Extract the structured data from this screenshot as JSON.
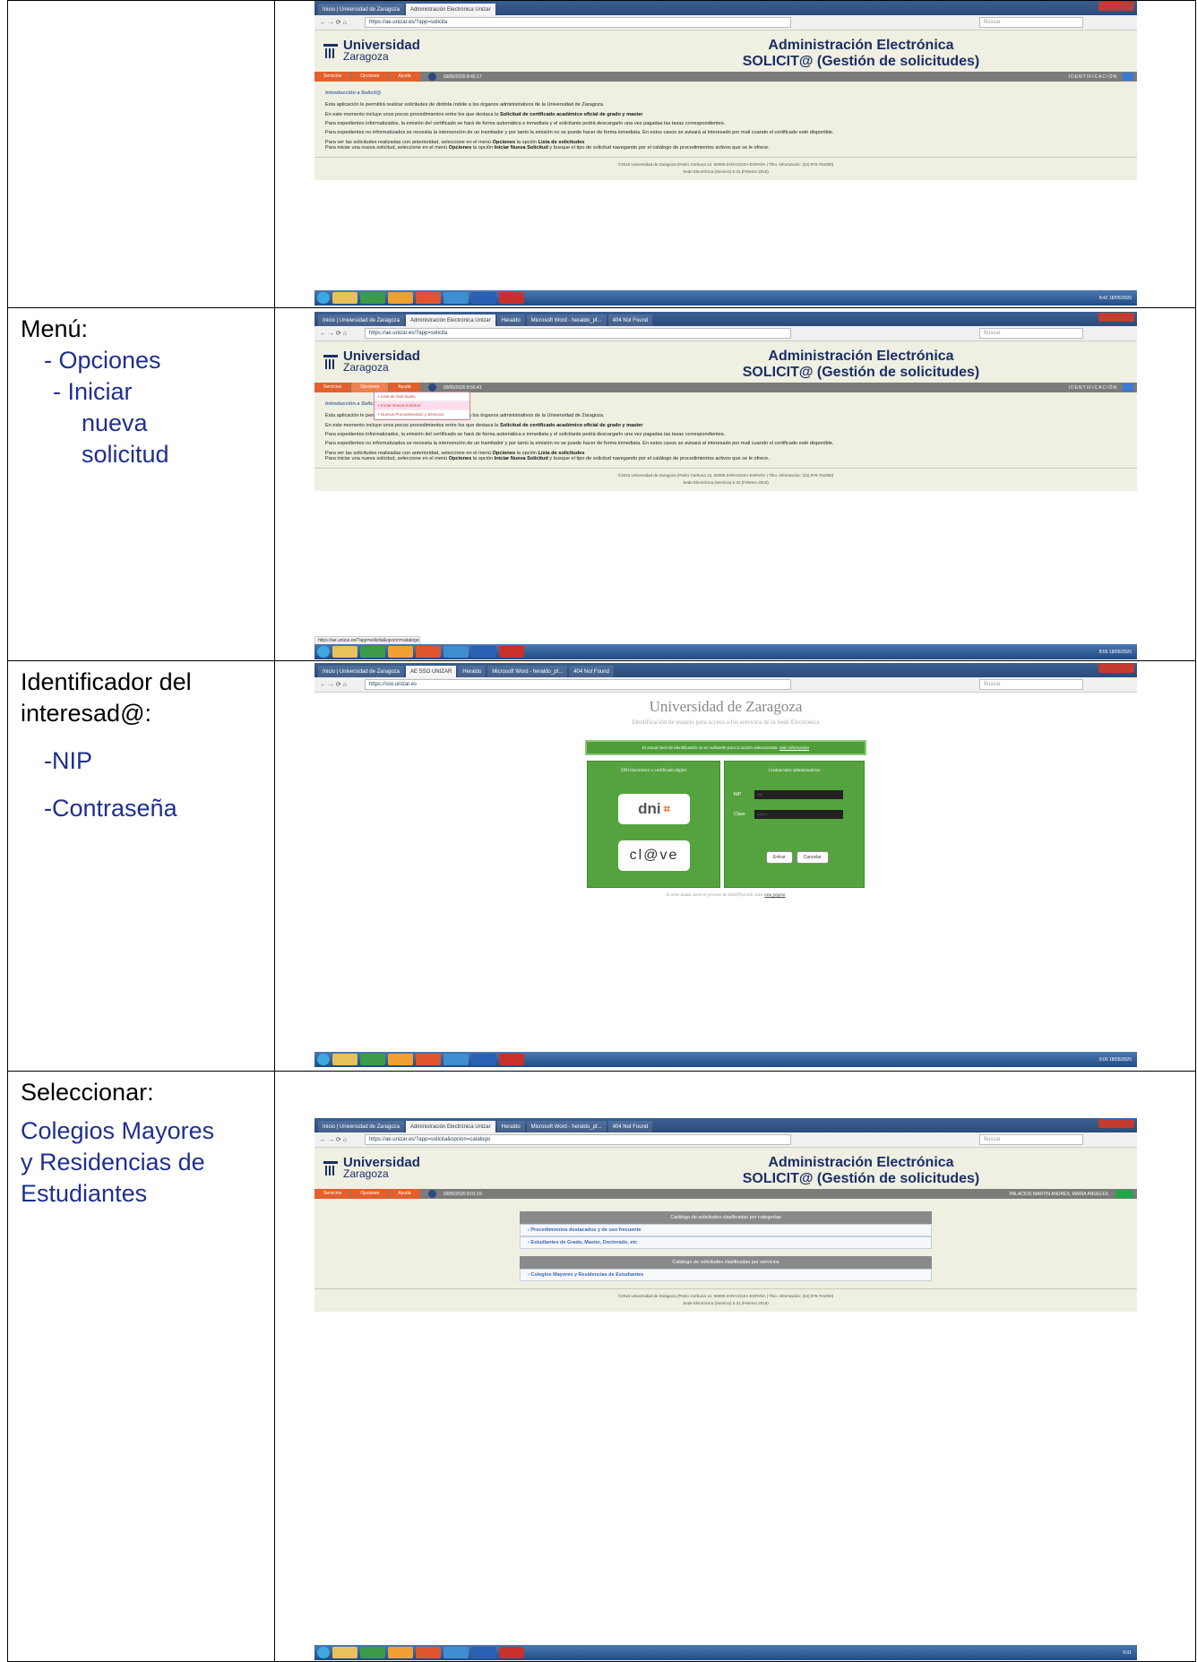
{
  "rows": [
    {
      "label_lines": [],
      "items": []
    },
    {
      "label_lines": [
        "Menú:"
      ],
      "items": [
        "- Opciones",
        "- Iniciar",
        "nueva",
        "solicitud"
      ]
    },
    {
      "label_lines": [
        "Identificador del",
        "interesad@:"
      ],
      "items": [
        "-NIP",
        "-Contraseña"
      ]
    },
    {
      "label_lines": [
        "Seleccionar:"
      ],
      "items": [
        "Colegios Mayores",
        "y Residencias de",
        "Estudiantes"
      ]
    }
  ],
  "browser": {
    "tabs1": [
      "Inicio | Universidad de Zaragoza",
      "Administración Electrónica Unizar"
    ],
    "tabs2": [
      "Inicio | Universidad de Zaragoza",
      "Administración Electrónica Unizar",
      "Heraldo",
      "Microsoft Word - heraldo_pf...",
      "404 Not Found"
    ],
    "tabs3": [
      "Inicio | Universidad de Zaragoza",
      "AE SSO UNIZAR",
      "Heraldo",
      "Microsoft Word - heraldo_pf...",
      "404 Not Found"
    ],
    "tabs4": [
      "Inicio | Universidad de Zaragoza",
      "Administración Electrónica Unizar",
      "Heraldo",
      "Microsoft Word - heraldo_pf...",
      "404 Not Found"
    ],
    "url1": "https://ae.unizar.es/?app=solicita",
    "url2": "https://ae.unizar.es/?app=solicita",
    "url3": "https://sso.unizar.es",
    "url4": "https://ae.unizar.es/?app=solicita&opcion=catalogo",
    "search": "Buscar",
    "status_url": "https://ae.unizar.es/?app=solicita&opcion=catalogo"
  },
  "app": {
    "logo_main": "Universidad",
    "logo_sub": "Zaragoza",
    "title1": "Administración Electrónica",
    "title2": "SOLICIT@ (Gestión de solicitudes)",
    "menu": [
      "Servicios",
      "Opciones",
      "Ayuda"
    ],
    "date1": "18/05/2020 8:42:17",
    "date2": "18/05/2020 8:56:41",
    "date4": "18/05/2020 9:01:19",
    "ident": "IDENTIFICACIÓN",
    "user": "PALACIOS MARTIN ANDRES, MARIA ANGELES",
    "intro_title": "Introducción a Solicit@",
    "p1": "Esta aplicación le permitirá realizar solicitudes de distinta índole a los órganos administrativos de la Universidad de Zaragoza.",
    "p2a": "En este momento incluye unos pocos procedimientos entre los que destaca la ",
    "p2b": "Solicitud de certificado académico oficial de grado y master",
    "p3": "Para expedientes informatizados, la emisión del certificado se hará de forma automática e inmediata y el solicitante podrá descargarlo una vez pagadas las tasas correspondientes.",
    "p4": "Para expedientes no informatizados se necesita la intervención de un tramitador y por tanto la emisión no se puede hacer de forma inmediata. En estos casos se avisará al interesado por mail cuando el certificado esté disponible.",
    "p5a": "Para ver las solicitudes realizadas con anterioridad, seleccione en el menú ",
    "p5b": "Opciones",
    "p5c": " la opción ",
    "p5d": "Lista de solicitudes",
    "p6a": "Para iniciar una nueva solicitud, seleccione en el menú ",
    "p6b": "Opciones",
    "p6c": " la opción ",
    "p6d": "Iniciar Nueva Solicitud",
    "p6e": " y busque el tipo de solicitud navegando por el catálogo de procedimientos activos que se le ofrece.",
    "foot1": "©2015 Universidad de Zaragoza (Pedro Cerbuna 12, 50009 ZARAGOZA-ESPAÑA | Tfno. Información: (34) 976-761000)",
    "foot2": "Sede Electrónica (Servicio) 0.31 (Febrero 2019)",
    "dropdown": [
      "• Lista de Solicitudes",
      "• Iniciar Nueva Solicitud",
      "• Nuevos Procedimientos y Servicios"
    ]
  },
  "sso": {
    "title": "Universidad de Zaragoza",
    "subtitle": "Identificación de usuario para acceso a los servicios de la Sede Electrónica",
    "warn": "El actual nivel de identificación no es suficiente para la acción seleccionada.",
    "warn_link": "Más información",
    "left_h": "DNI electrónico o certificado digital",
    "dni": "dni",
    "clave": "cl@ve",
    "right_h": "Credenciales administrativas",
    "nip": "NIP",
    "clave_lbl": "Clave",
    "nip_val": "nip",
    "clave_val": "••••••••",
    "enter": "Entrar",
    "cancel": "Cancelar",
    "help": "Si tiene dudas sobre el proceso de identificación visite ",
    "help_link": "esta página"
  },
  "catalog": {
    "h1": "Catálogo de solicitudes clasificadas por categorías",
    "i1": "›  Procedimientos destacados y de uso frecuente",
    "i2": "›  Estudiantes de Grado, Master, Doctorado, etc",
    "h2": "Catálogo de solicitudes clasificadas por servicios",
    "i3": "›  Colegios Mayores y Residencias de Estudiantes"
  },
  "taskbar": {
    "clock1": "8:42 18/05/2020",
    "clock2": "8:56 18/05/2020",
    "clock3": "9:00 18/05/2020",
    "clock4": "9:01"
  }
}
